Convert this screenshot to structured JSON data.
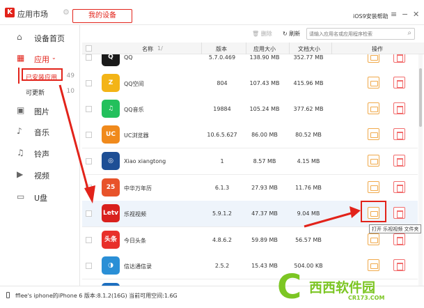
{
  "titlebar": {
    "logo_letter": "K",
    "app_name": "应用市场",
    "my_device": "我的设备",
    "help": "iOS9安装帮助"
  },
  "sidebar": {
    "items": [
      {
        "label": "设备首页",
        "icon": "home-icon"
      },
      {
        "label": "应用",
        "icon": "apps-grid-icon"
      },
      {
        "label": "图片",
        "icon": "image-icon"
      },
      {
        "label": "音乐",
        "icon": "music-note-icon"
      },
      {
        "label": "铃声",
        "icon": "bell-icon"
      },
      {
        "label": "视频",
        "icon": "video-icon"
      },
      {
        "label": "U盘",
        "icon": "usb-drive-icon"
      }
    ],
    "sub": [
      {
        "label": "已安装应用",
        "count": "49"
      },
      {
        "label": "可更新",
        "count": "10"
      }
    ]
  },
  "toolbar": {
    "delete_label": "删除",
    "refresh_label": "刷新",
    "search_placeholder": "请输入应用名或应用程序检索"
  },
  "table": {
    "headers": {
      "name": "名称",
      "sort": "1/",
      "version": "版本",
      "app_size": "应用大小",
      "doc_size": "文档大小",
      "action": "操作"
    },
    "rows": [
      {
        "name": "QQ",
        "version": "5.7.0.469",
        "app_size": "138.90 MB",
        "doc_size": "352.77 MB",
        "icon_text": "Q",
        "icon_color": "#1a1a1a"
      },
      {
        "name": "QQ空间",
        "version": "804",
        "app_size": "107.43 MB",
        "doc_size": "415.96 MB",
        "icon_text": "Z",
        "icon_color": "#f3b417"
      },
      {
        "name": "QQ音乐",
        "version": "19884",
        "app_size": "105.24 MB",
        "doc_size": "377.62 MB",
        "icon_text": "♫",
        "icon_color": "#23c05c"
      },
      {
        "name": "UC浏览器",
        "version": "10.6.5.627",
        "app_size": "86.00 MB",
        "doc_size": "80.52 MB",
        "icon_text": "UC",
        "icon_color": "#f08a1c"
      },
      {
        "name": "Xiao xiangtong",
        "version": "1",
        "app_size": "8.57 MB",
        "doc_size": "4.15 MB",
        "icon_text": "◎",
        "icon_color": "#1e4f95"
      },
      {
        "name": "中华万年历",
        "version": "6.1.3",
        "app_size": "27.93 MB",
        "doc_size": "11.76 MB",
        "icon_text": "25",
        "icon_color": "#e8532a"
      },
      {
        "name": "乐视视频",
        "version": "5.9.1.2",
        "app_size": "47.37 MB",
        "doc_size": "9.04 MB",
        "icon_text": "Letv",
        "icon_color": "#d9211d"
      },
      {
        "name": "今日头条",
        "version": "4.8.6.2",
        "app_size": "59.89 MB",
        "doc_size": "56.57 MB",
        "icon_text": "头条",
        "icon_color": "#e8302a"
      },
      {
        "name": "信达通信录",
        "version": "2.5.2",
        "app_size": "15.43 MB",
        "doc_size": "504.00 KB",
        "icon_text": "◑",
        "icon_color": "#2a8fd6"
      },
      {
        "name": "",
        "version": "",
        "app_size": "",
        "doc_size": "",
        "icon_text": "",
        "icon_color": "#1d6fc0"
      }
    ]
  },
  "tooltip": "打开 乐视视频 文件夹",
  "statusbar": {
    "text": "fflee's iphone的iPhone 6   版本:8.1.2(16G)  当前可用空间:1.6G"
  },
  "watermark": {
    "text": "西西软件园",
    "sub": "CR173.COM"
  },
  "colors": {
    "accent": "#e2231a",
    "folder": "#f0a94a",
    "trash": "#f26d6d"
  }
}
